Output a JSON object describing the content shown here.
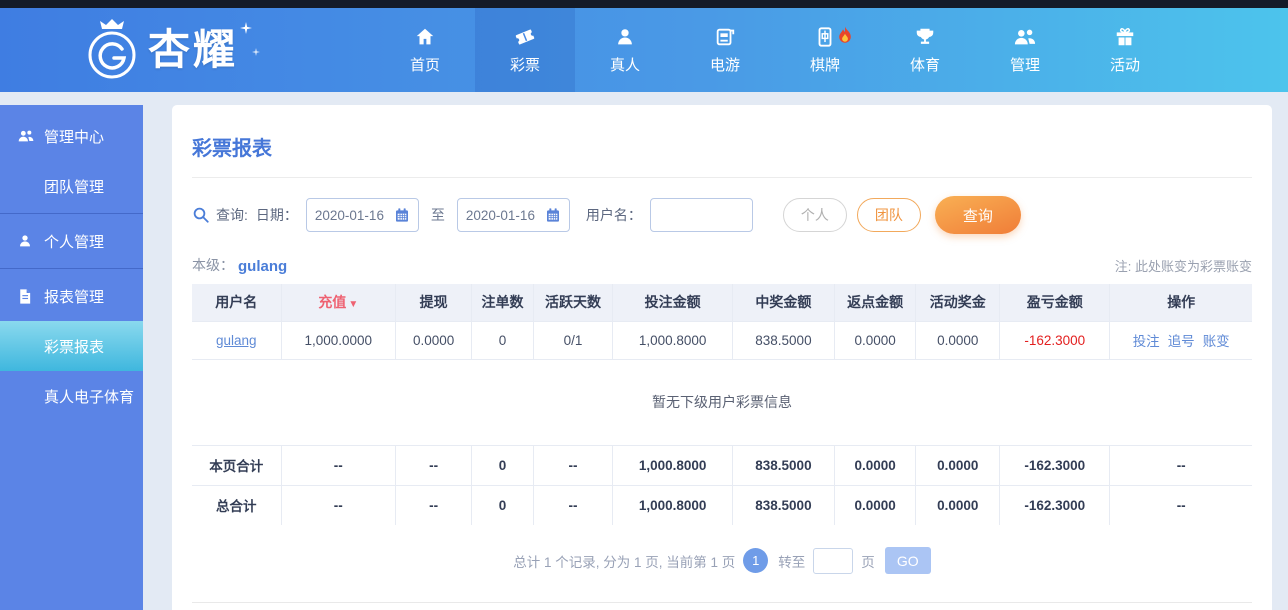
{
  "brand": {
    "name": "杏耀"
  },
  "nav": {
    "items": [
      {
        "label": "首页"
      },
      {
        "label": "彩票",
        "active": true
      },
      {
        "label": "真人"
      },
      {
        "label": "电游"
      },
      {
        "label": "棋牌",
        "hot": true
      },
      {
        "label": "体育"
      },
      {
        "label": "管理"
      },
      {
        "label": "活动"
      }
    ]
  },
  "sidebar": {
    "items": [
      {
        "label": "管理中心"
      },
      {
        "label": "团队管理"
      },
      {
        "label": "个人管理"
      },
      {
        "label": "报表管理"
      },
      {
        "label": "彩票报表",
        "active": true
      },
      {
        "label": "真人电子体育"
      }
    ]
  },
  "page": {
    "title": "彩票报表",
    "note": "注: 此处账变为彩票账变",
    "level_label": "本级：",
    "level_value": "gulang"
  },
  "search": {
    "query_label": "查询:",
    "date_label": "日期：",
    "date_from": "2020-01-16",
    "to_label": "至",
    "date_to": "2020-01-16",
    "username_label": "用户名：",
    "username_value": "",
    "personal_button": "个人",
    "team_button": "团队",
    "query_button": "查询"
  },
  "icons": {
    "sort_desc": "▼"
  },
  "table": {
    "headers": [
      "用户名",
      "充值",
      "提现",
      "注单数",
      "活跃天数",
      "投注金额",
      "中奖金额",
      "返点金额",
      "活动奖金",
      "盈亏金额",
      "操作"
    ],
    "row": {
      "username": "gulang",
      "recharge": "1,000.0000",
      "withdraw": "0.0000",
      "bet_count": "0",
      "active_days": "0/1",
      "bet_amount": "1,000.8000",
      "win_amount": "838.5000",
      "rebate": "0.0000",
      "activity_bonus": "0.0000",
      "profit": "-162.3000",
      "actions": {
        "bet": "投注",
        "chase": "追号",
        "account_change": "账变"
      }
    },
    "empty_text": "暂无下级用户彩票信息",
    "page_total": {
      "label": "本页合计",
      "values": [
        "--",
        "--",
        "0",
        "--",
        "1,000.8000",
        "838.5000",
        "0.0000",
        "0.0000",
        "-162.3000",
        "--"
      ]
    },
    "grand_total": {
      "label": "总合计",
      "values": [
        "--",
        "--",
        "0",
        "--",
        "1,000.8000",
        "838.5000",
        "0.0000",
        "0.0000",
        "-162.3000",
        "--"
      ]
    }
  },
  "pagination": {
    "summary": "总计 1 个记录, 分为 1 页, 当前第 1 页",
    "current_page": "1",
    "goto_label": "转至",
    "goto_value": "",
    "page_unit": "页",
    "go_button": "GO"
  },
  "colors": {
    "accent_blue": "#4a7dd8",
    "nav_gradient_start": "#3f7de2",
    "nav_gradient_end": "#4cc4ec",
    "sidebar_blue": "#5b84e6",
    "active_cyan": "#3fb7de",
    "button_orange": "#f0873c",
    "sort_red": "#ee6272",
    "negative_red": "#e31f1f"
  }
}
